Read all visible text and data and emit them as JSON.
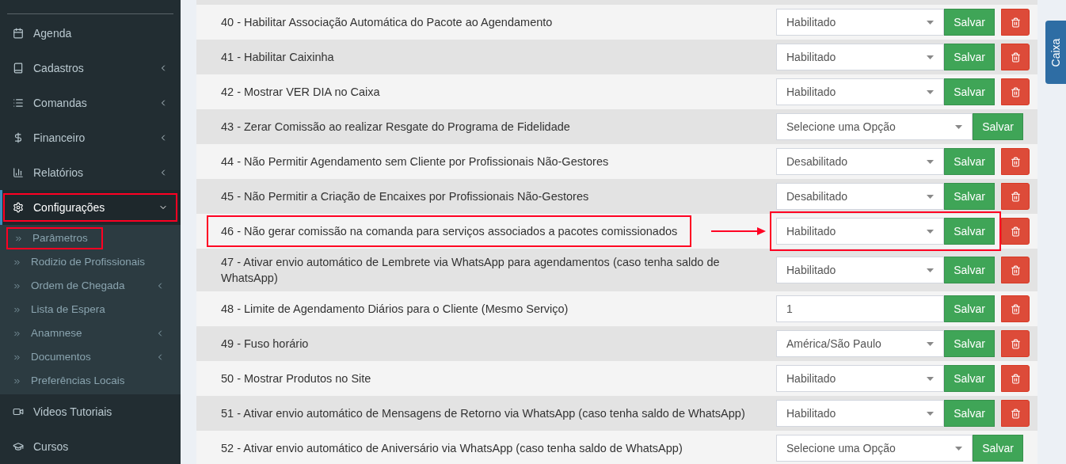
{
  "sidebar": {
    "items": [
      {
        "label": "Agenda",
        "has_submenu": false,
        "expanded": false,
        "highlighted": false
      },
      {
        "label": "Cadastros",
        "has_submenu": true,
        "expanded": false,
        "highlighted": false
      },
      {
        "label": "Comandas",
        "has_submenu": true,
        "expanded": false,
        "highlighted": false
      },
      {
        "label": "Financeiro",
        "has_submenu": true,
        "expanded": false,
        "highlighted": false
      },
      {
        "label": "Relatórios",
        "has_submenu": true,
        "expanded": false,
        "highlighted": false
      },
      {
        "label": "Configurações",
        "has_submenu": true,
        "expanded": true,
        "highlighted": true,
        "children": [
          {
            "label": "Parâmetros",
            "has_submenu": false,
            "highlighted": true
          },
          {
            "label": "Rodizio de Profissionais",
            "has_submenu": false,
            "highlighted": false
          },
          {
            "label": "Ordem de Chegada",
            "has_submenu": true,
            "highlighted": false
          },
          {
            "label": "Lista de Espera",
            "has_submenu": false,
            "highlighted": false
          },
          {
            "label": "Anamnese",
            "has_submenu": true,
            "highlighted": false
          },
          {
            "label": "Documentos",
            "has_submenu": true,
            "highlighted": false
          },
          {
            "label": "Preferências Locais",
            "has_submenu": false,
            "highlighted": false
          }
        ]
      },
      {
        "label": "Videos Tutoriais",
        "has_submenu": false,
        "expanded": false,
        "highlighted": false
      },
      {
        "label": "Cursos",
        "has_submenu": false,
        "expanded": false,
        "highlighted": false
      }
    ]
  },
  "parameters": [
    {
      "label": "40 - Habilitar Associação Automática do Pacote ao Agendamento",
      "kind": "select",
      "value": "Habilitado",
      "save": "Salvar",
      "deletable": true,
      "highlighted": false
    },
    {
      "label": "41 - Habilitar Caixinha",
      "kind": "select",
      "value": "Habilitado",
      "save": "Salvar",
      "deletable": true,
      "highlighted": false
    },
    {
      "label": "42 - Mostrar VER DIA no Caixa",
      "kind": "select",
      "value": "Habilitado",
      "save": "Salvar",
      "deletable": true,
      "highlighted": false
    },
    {
      "label": "43 - Zerar Comissão ao realizar Resgate do Programa de Fidelidade",
      "kind": "select",
      "value": "Selecione uma Opção",
      "save": "Salvar",
      "deletable": false,
      "highlighted": false
    },
    {
      "label": "44 - Não Permitir Agendamento sem Cliente por Profissionais Não-Gestores",
      "kind": "select",
      "value": "Desabilitado",
      "save": "Salvar",
      "deletable": true,
      "highlighted": false
    },
    {
      "label": "45 - Não Permitir a Criação de Encaixes por Profissionais Não-Gestores",
      "kind": "select",
      "value": "Desabilitado",
      "save": "Salvar",
      "deletable": true,
      "highlighted": false
    },
    {
      "label": "46 - Não gerar comissão na comanda para serviços associados a pacotes comissionados",
      "kind": "select",
      "value": "Habilitado",
      "save": "Salvar",
      "deletable": true,
      "highlighted": true
    },
    {
      "label": "47 - Ativar envio automático de Lembrete via WhatsApp para agendamentos (caso tenha saldo de WhatsApp)",
      "kind": "select",
      "value": "Habilitado",
      "save": "Salvar",
      "deletable": true,
      "highlighted": false
    },
    {
      "label": "48 - Limite de Agendamento Diários para o Cliente (Mesmo Serviço)",
      "kind": "input",
      "value": "1",
      "save": "Salvar",
      "deletable": true,
      "highlighted": false
    },
    {
      "label": "49 - Fuso horário",
      "kind": "select",
      "value": "América/São Paulo",
      "save": "Salvar",
      "deletable": true,
      "highlighted": false
    },
    {
      "label": "50 - Mostrar Produtos no Site",
      "kind": "select",
      "value": "Habilitado",
      "save": "Salvar",
      "deletable": true,
      "highlighted": false
    },
    {
      "label": "51 - Ativar envio automático de Mensagens de Retorno via WhatsApp (caso tenha saldo de WhatsApp)",
      "kind": "select",
      "value": "Habilitado",
      "save": "Salvar",
      "deletable": true,
      "highlighted": false
    },
    {
      "label": "52 - Ativar envio automático de Aniversário via WhatsApp (caso tenha saldo de WhatsApp)",
      "kind": "select",
      "value": "Selecione uma Opção",
      "save": "Salvar",
      "deletable": false,
      "highlighted": false
    }
  ],
  "side_tab": {
    "label": "Caixa"
  }
}
